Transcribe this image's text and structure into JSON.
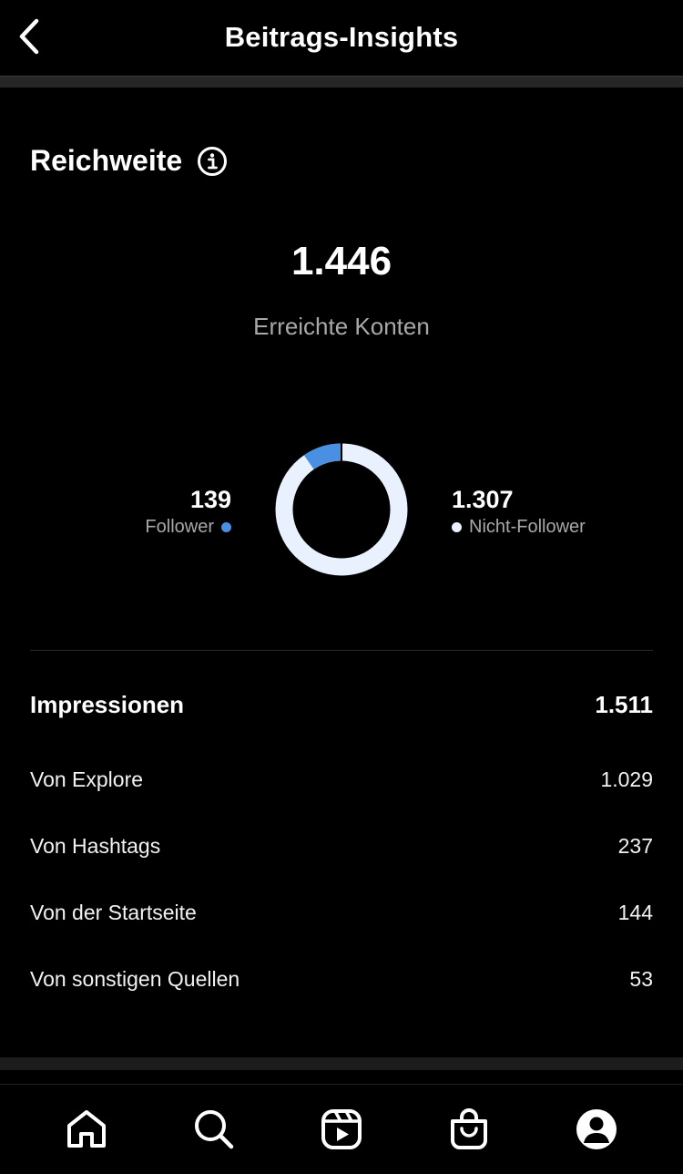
{
  "header": {
    "title": "Beitrags-Insights",
    "back_icon": "chevron-left-icon"
  },
  "reach": {
    "title": "Reichweite",
    "info_icon": "info-icon",
    "value": "1.446",
    "label": "Erreichte Konten",
    "followers": {
      "value": "139",
      "label": "Follower",
      "count": 139,
      "color": "#4a90e2"
    },
    "non_followers": {
      "value": "1.307",
      "label": "Nicht-Follower",
      "count": 1307,
      "color": "#e8f1fd"
    }
  },
  "impressions": {
    "title": "Impressionen",
    "total": "1.511",
    "rows": [
      {
        "label": "Von Explore",
        "value": "1.029"
      },
      {
        "label": "Von Hashtags",
        "value": "237"
      },
      {
        "label": "Von der Startseite",
        "value": "144"
      },
      {
        "label": "Von sonstigen Quellen",
        "value": "53"
      }
    ]
  },
  "tabbar": {
    "items": [
      "home-icon",
      "search-icon",
      "reels-icon",
      "shop-icon",
      "profile-icon"
    ]
  }
}
